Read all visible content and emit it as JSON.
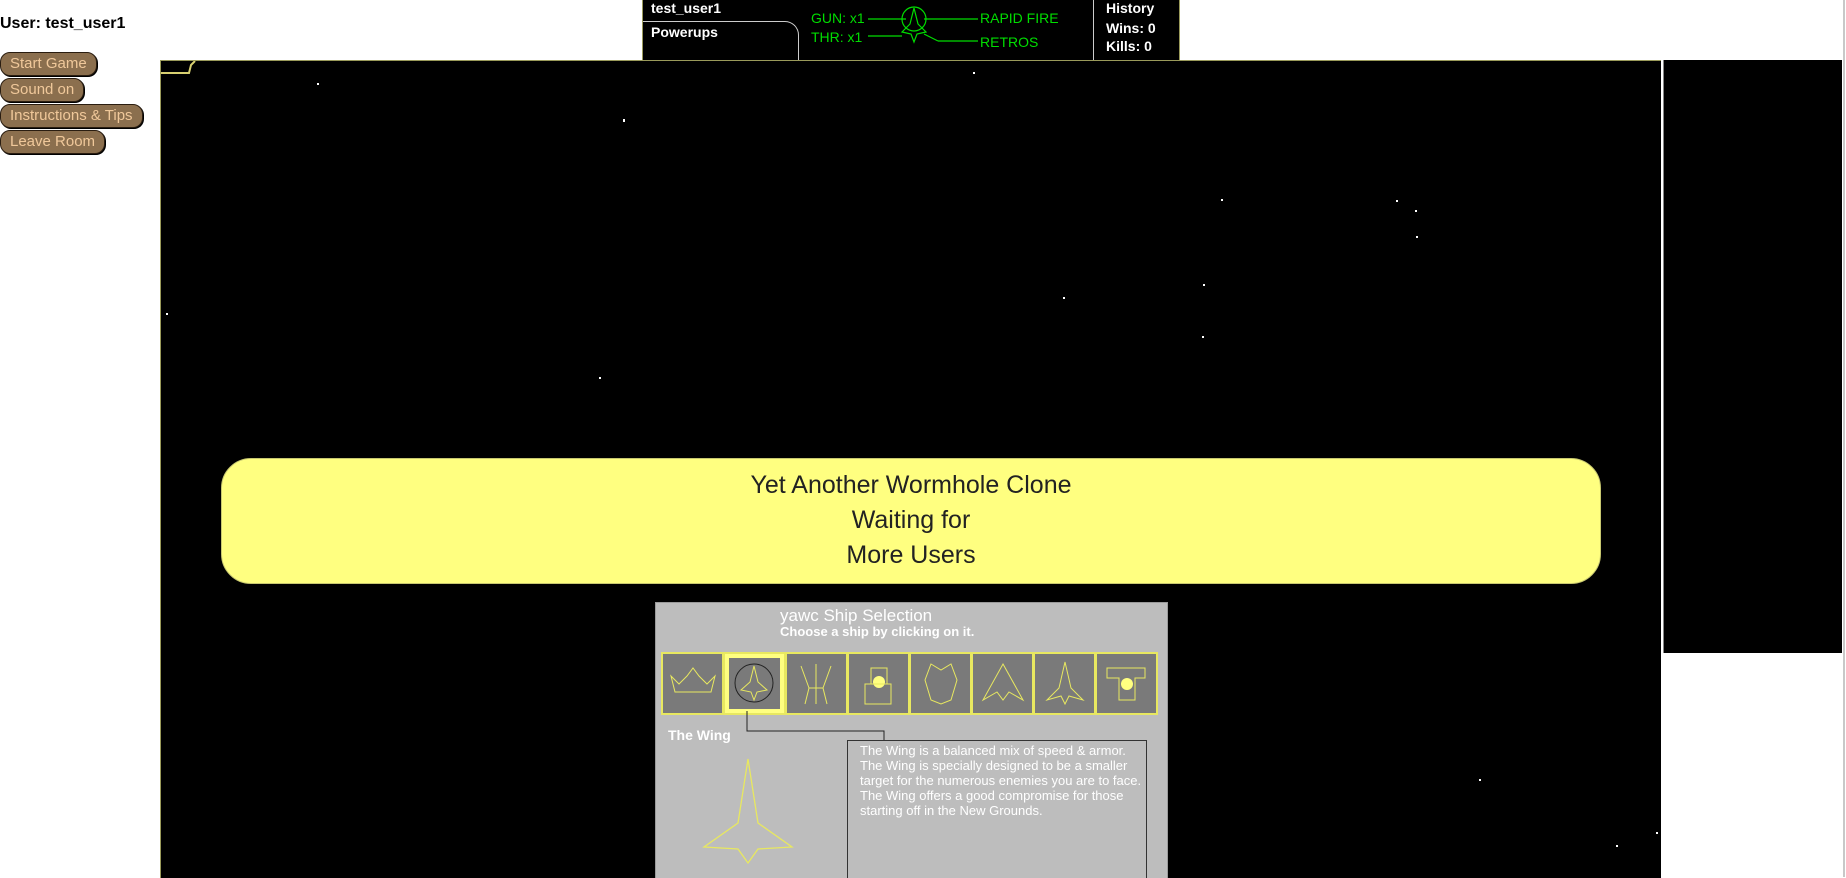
{
  "user": {
    "label": "User: test_user1"
  },
  "menu": {
    "buttons": [
      {
        "label": "Start Game"
      },
      {
        "label": "Sound on"
      },
      {
        "label": "Instructions & Tips"
      },
      {
        "label": "Leave Room"
      }
    ]
  },
  "hud": {
    "username": "test_user1",
    "powerups_tab": "Powerups",
    "gun": "GUN: x1",
    "thr": "THR: x1",
    "rapid_fire": "RAPID FIRE",
    "retros": "RETROS",
    "history": {
      "title": "History",
      "wins": "Wins: 0",
      "kills": "Kills: 0"
    }
  },
  "banner": {
    "line1": "Yet Another Wormhole Clone",
    "line2": "Waiting for",
    "line3": "More Users"
  },
  "ship_selection": {
    "title": "yawc Ship Selection",
    "subtitle": "Choose a ship by clicking on it.",
    "selected_index": 1,
    "ships": [
      "ship-1",
      "ship-2",
      "ship-3",
      "ship-4",
      "ship-5",
      "ship-6",
      "ship-7",
      "ship-8"
    ],
    "selected_name": "The Wing",
    "description": "The Wing is a balanced mix of speed & armor.  The Wing is specially designed to be a smaller target for the numerous enemies you are to face.  The Wing offers a good compromise for those starting off in the New Grounds."
  },
  "colors": {
    "accent_yellow": "#ffff80",
    "hud_green": "#00dd00",
    "button_brown": "#8b6f4e"
  }
}
